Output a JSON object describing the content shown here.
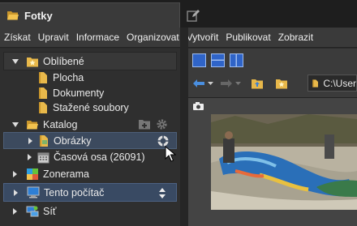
{
  "window": {
    "tab_title": "Fotky"
  },
  "menu": [
    "Získat",
    "Upravit",
    "Informace",
    "Organizovat",
    "Vytvořit",
    "Publikovat",
    "Zobrazit"
  ],
  "sidebar": {
    "favorites": {
      "label": "Oblíbené",
      "items": [
        {
          "label": "Plocha"
        },
        {
          "label": "Dokumenty"
        },
        {
          "label": "Stažené soubory"
        }
      ]
    },
    "catalog": {
      "label": "Katalog",
      "items": [
        {
          "label": "Obrázky"
        },
        {
          "label": "Časová osa (26091)"
        },
        {
          "label": "Zonerama"
        }
      ]
    },
    "computer": {
      "label": "Tento počítač"
    },
    "network": {
      "label": "Síť"
    }
  },
  "browser": {
    "path": "C:\\User"
  },
  "colors": {
    "accent": "#4a7fd4",
    "folder": "#e8b84a",
    "selected_row": "#3c4a5e"
  }
}
